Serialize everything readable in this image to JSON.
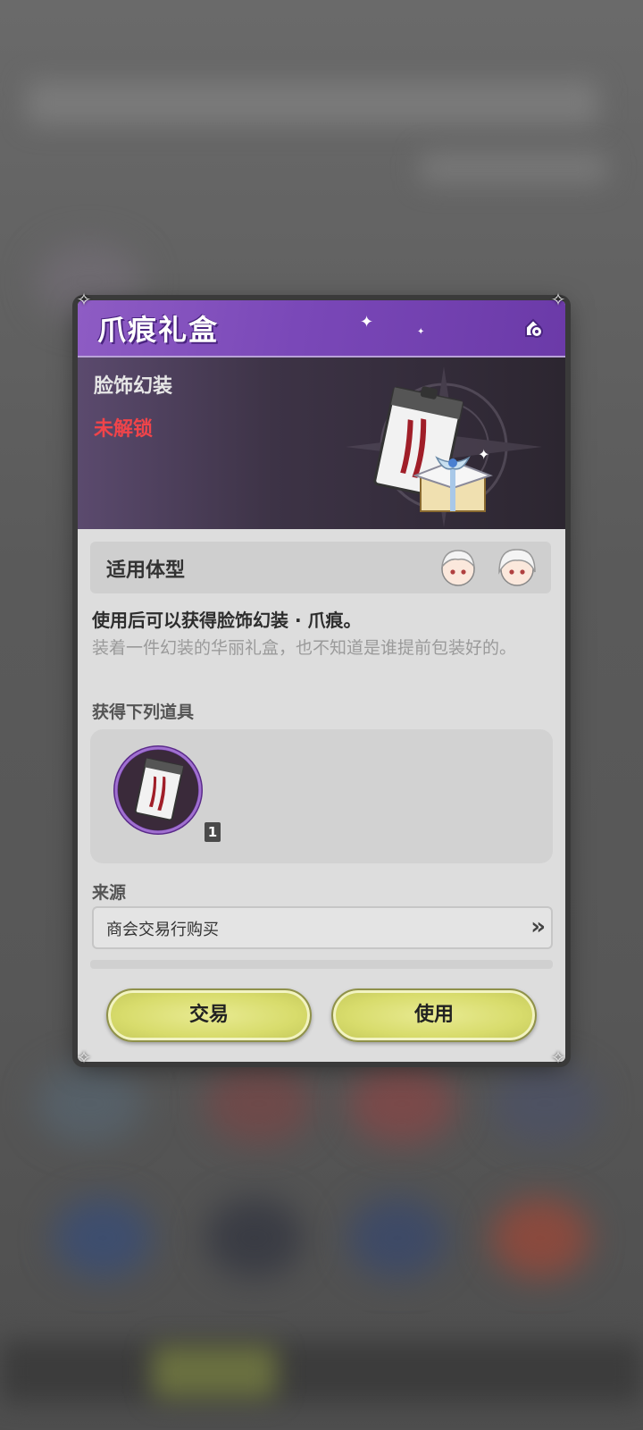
{
  "dialog": {
    "title": "爪痕礼盒",
    "help_icon": "help-gear-icon",
    "category": "脸饰幻装",
    "lock_status": "未解锁",
    "body_type_label": "适用体型",
    "description_main": "使用后可以获得脸饰幻装 · 爪痕。",
    "description_sub": "装着一件幻装的华丽礼盒，也不知道是谁提前包装好的。",
    "rewards_label": "获得下列道具",
    "rewards": [
      {
        "icon": "claw-mark-card-icon",
        "count": "1"
      }
    ],
    "source_label": "来源",
    "source_item": "商会交易行购买",
    "source_arrow": "»",
    "buttons": {
      "trade": "交易",
      "use": "使用"
    },
    "colors": {
      "title_bar": "#7a48b8",
      "lock_red": "#f0444a",
      "button_yellow": "#d8dc6c"
    }
  }
}
